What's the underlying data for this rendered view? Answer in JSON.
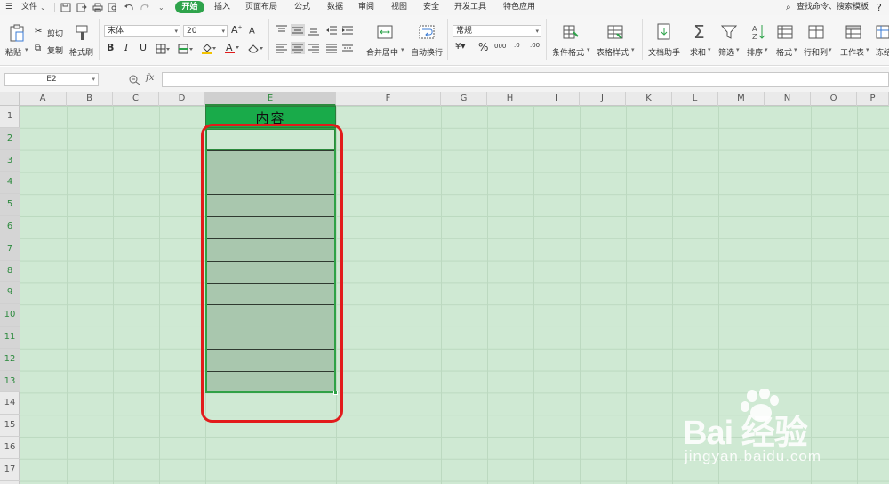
{
  "menu": {
    "file_label": "文件",
    "start_tab": "开始",
    "tabs": [
      "插入",
      "页面布局",
      "公式",
      "数据",
      "审阅",
      "视图",
      "安全",
      "开发工具",
      "特色应用"
    ],
    "search_label": "查找命令、搜索模板",
    "help_label": "?"
  },
  "ribbon": {
    "paste": "粘贴",
    "cut": "剪切",
    "copy": "复制",
    "format_painter": "格式刷",
    "font_name": "宋体",
    "font_size": "20",
    "font_grow": "A",
    "font_shrink": "A",
    "bold": "B",
    "italic": "I",
    "underline": "U",
    "merge_center": "合并居中",
    "wrap_text": "自动换行",
    "number_format": "常规",
    "percent": "%",
    "thousands": "000",
    "inc_decimal": ".0",
    "dec_decimal": ".00",
    "cond_format": "条件格式",
    "table_style": "表格样式",
    "doc_assistant": "文档助手",
    "sum": "求和",
    "filter": "筛选",
    "sort": "排序",
    "format": "格式",
    "row_col": "行和列",
    "worksheet": "工作表",
    "freeze": "冻结"
  },
  "formula_bar": {
    "name_box": "E2",
    "fx": "fx",
    "value": ""
  },
  "grid": {
    "columns": [
      "A",
      "B",
      "C",
      "D",
      "E",
      "F",
      "G",
      "H",
      "I",
      "J",
      "K",
      "L",
      "M",
      "N",
      "O",
      "P"
    ],
    "selected_column": "E",
    "rows": [
      "1",
      "2",
      "3",
      "4",
      "5",
      "6",
      "7",
      "8",
      "9",
      "10",
      "11",
      "12",
      "13",
      "14",
      "15",
      "16",
      "17"
    ],
    "selected_rows": [
      "2",
      "3",
      "4",
      "5",
      "6",
      "7",
      "8",
      "9",
      "10",
      "11",
      "12",
      "13"
    ],
    "header_cell_text": "内容"
  },
  "watermark": {
    "brand": "Bai 经验",
    "url": "jingyan.baidu.com"
  },
  "colors": {
    "accent": "#2ea34b",
    "grid_bg": "#cfe9d3",
    "header_fill": "#19ab4a",
    "selection_fill": "#a9c7ae",
    "annotation": "#e21b1b"
  }
}
